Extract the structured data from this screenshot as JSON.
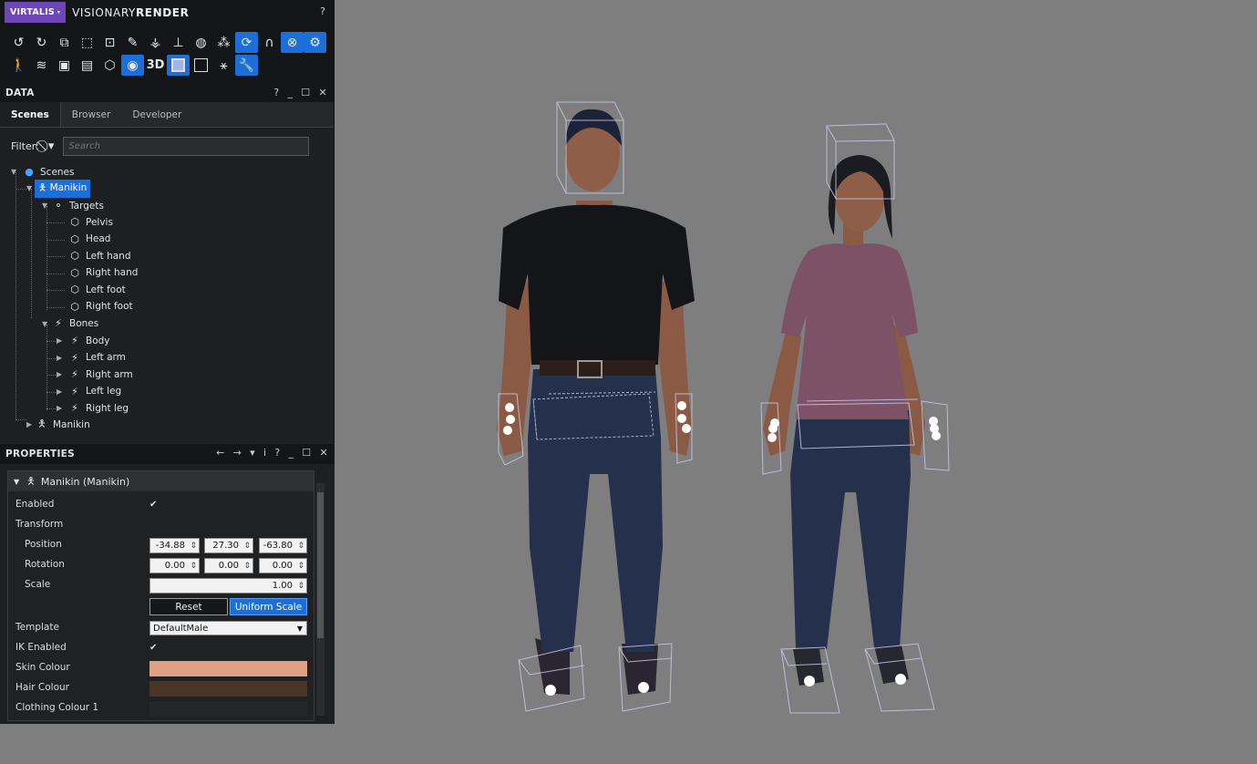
{
  "app": {
    "brand": "VIRTALIS",
    "title_light": "VISIONARY",
    "title_bold": "RENDER",
    "help": "?"
  },
  "toolbar": {
    "row1": [
      {
        "icon": "undo-icon",
        "glyph": "↺",
        "on": false
      },
      {
        "icon": "redo-icon",
        "glyph": "↻",
        "on": false
      },
      {
        "icon": "copy-icon",
        "glyph": "⧉",
        "on": false
      },
      {
        "icon": "select-box-icon",
        "glyph": "⬚",
        "on": false
      },
      {
        "icon": "zoom-fit-icon",
        "glyph": "⊡",
        "on": false
      },
      {
        "icon": "edit-icon",
        "glyph": "✎",
        "on": false
      },
      {
        "icon": "hierarchy-icon",
        "glyph": "⚶",
        "on": false
      },
      {
        "icon": "axes-icon",
        "glyph": "⊥",
        "on": false
      },
      {
        "icon": "sphere-icon",
        "glyph": "◍",
        "on": false
      },
      {
        "icon": "nodes-icon",
        "glyph": "⁂",
        "on": false
      },
      {
        "icon": "refresh-view-icon",
        "glyph": "⟳",
        "on": true
      },
      {
        "icon": "magnet-icon",
        "glyph": "∩",
        "on": false
      },
      {
        "icon": "collision-icon",
        "glyph": "⊗",
        "on": true
      },
      {
        "icon": "physics-icon",
        "glyph": "⚙",
        "on": true
      }
    ],
    "row2": [
      {
        "icon": "walk-icon",
        "glyph": "🚶",
        "on": false
      },
      {
        "icon": "wifi-icon",
        "glyph": "≋",
        "on": false
      },
      {
        "icon": "image-icon",
        "glyph": "▣",
        "on": false
      },
      {
        "icon": "document-icon",
        "glyph": "▤",
        "on": false
      },
      {
        "icon": "cube-icon",
        "glyph": "⬡",
        "on": false
      },
      {
        "icon": "light-icon",
        "glyph": "◉",
        "on": true
      },
      {
        "icon": "3d-label",
        "glyph": "3D",
        "on": false,
        "label": true
      },
      {
        "icon": "solid-square-icon",
        "glyph": "",
        "on": true,
        "square": "filled"
      },
      {
        "icon": "empty-square-icon",
        "glyph": "",
        "on": false,
        "square": "empty"
      },
      {
        "icon": "skeleton-icon",
        "glyph": "⚹",
        "on": false
      },
      {
        "icon": "settings-wrench-icon",
        "glyph": "🔧",
        "on": true
      }
    ]
  },
  "data_panel": {
    "title": "DATA",
    "tabs": [
      "Scenes",
      "Browser",
      "Developer"
    ],
    "filter_label": "Filter:",
    "search_placeholder": "Search",
    "tree": {
      "scenes": "Scenes",
      "manikin1": "Manikin",
      "targets": "Targets",
      "target_items": [
        "Pelvis",
        "Head",
        "Left hand",
        "Right hand",
        "Left foot",
        "Right foot"
      ],
      "bones": "Bones",
      "bone_items": [
        "Body",
        "Left arm",
        "Right arm",
        "Left leg",
        "Right leg"
      ],
      "manikin2": "Manikin"
    }
  },
  "properties": {
    "title": "PROPERTIES",
    "card_title": "Manikin (Manikin)",
    "labels": {
      "enabled": "Enabled",
      "transform": "Transform",
      "position": "Position",
      "rotation": "Rotation",
      "scale": "Scale",
      "template": "Template",
      "ik_enabled": "IK Enabled",
      "skin_colour": "Skin Colour",
      "hair_colour": "Hair Colour",
      "clothing_colour_1": "Clothing Colour 1"
    },
    "position": [
      "-34.88",
      "27.30",
      "-63.80"
    ],
    "rotation": [
      "0.00",
      "0.00",
      "0.00"
    ],
    "scale": "1.00",
    "reset_label": "Reset",
    "uniform_scale_label": "Uniform Scale",
    "template_value": "DefaultMale",
    "enabled": true,
    "ik_enabled": true,
    "colors": {
      "skin": "#e0a085",
      "hair": "#4a3327",
      "clothing1": "#242628"
    }
  },
  "viewport": {
    "background": "#7e7e7e"
  }
}
